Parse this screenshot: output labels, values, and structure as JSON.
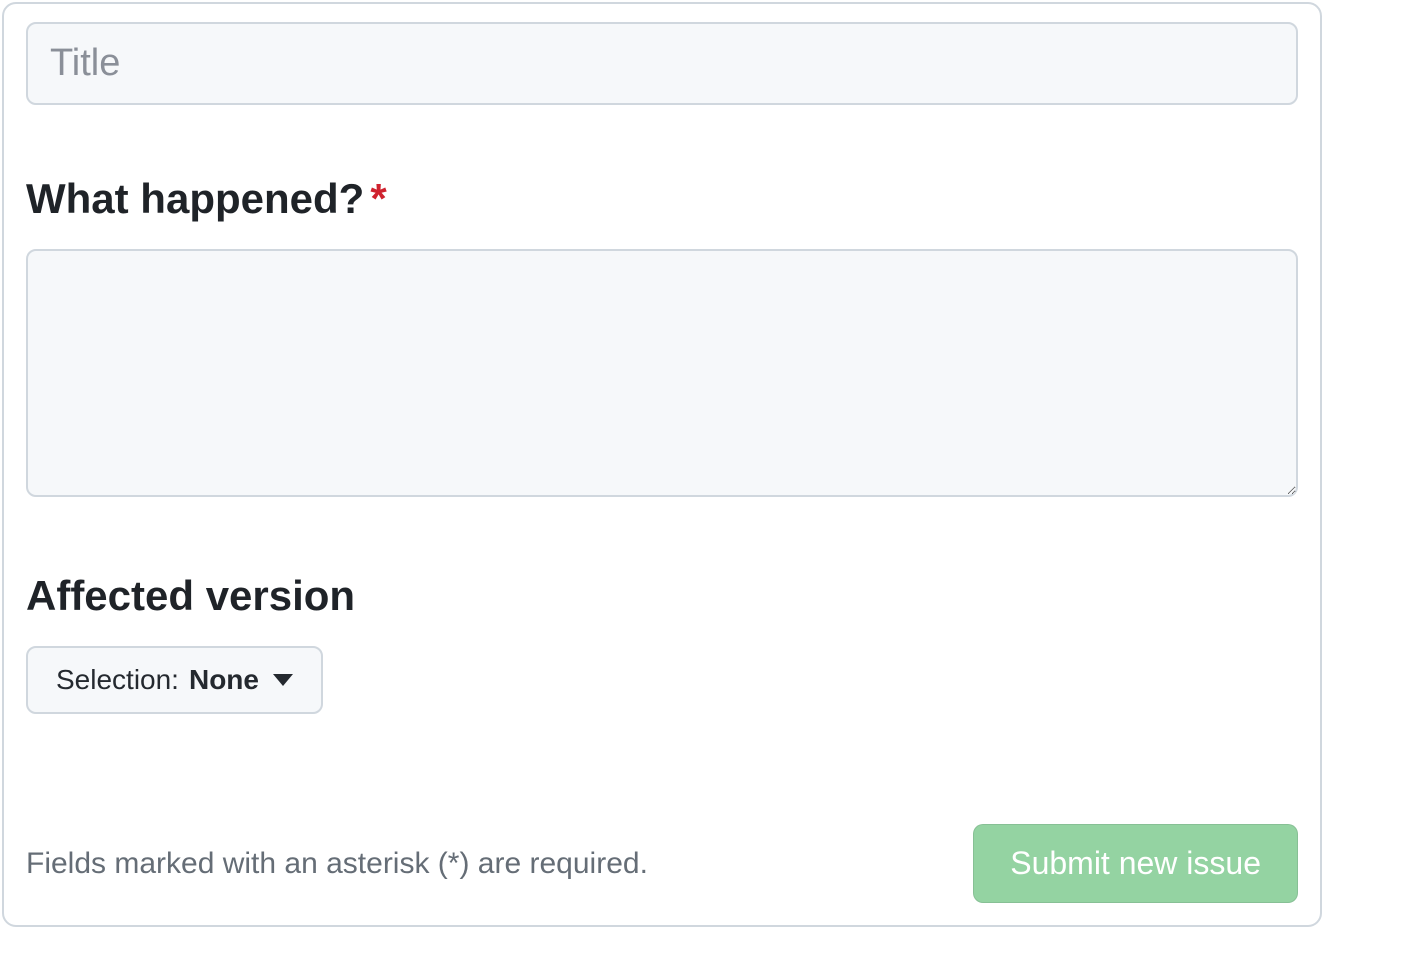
{
  "title": {
    "placeholder": "Title",
    "value": ""
  },
  "what_happened": {
    "label": "What happened?",
    "required_mark": "*",
    "value": ""
  },
  "affected_version": {
    "label": "Affected version",
    "selection_prefix": "Selection: ",
    "selection_value": "None"
  },
  "footer": {
    "note": "Fields marked with an asterisk (*) are required.",
    "submit_label": "Submit new issue"
  }
}
